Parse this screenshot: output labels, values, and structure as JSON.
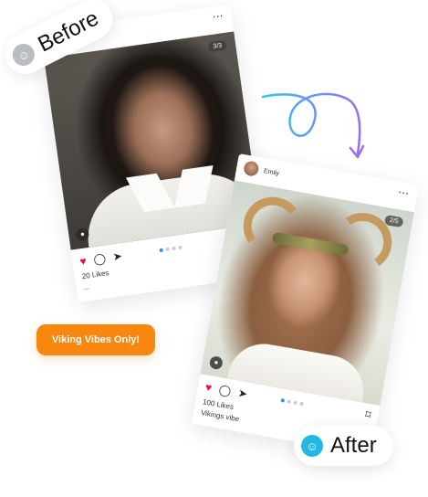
{
  "before_badge": {
    "label": "Before",
    "icon": "smiley-icon"
  },
  "after_badge": {
    "label": "After",
    "icon": "smiley-icon"
  },
  "before_post": {
    "counter": "3/3",
    "likes": "20 Likes",
    "caption": "..."
  },
  "after_post": {
    "username": "Emily",
    "counter": "2/5",
    "likes": "100 Likes",
    "caption": "Vikings vibe"
  },
  "tag": {
    "label": "Viking Vibes Only!"
  },
  "colors": {
    "heart": "#e5143a",
    "tag_bg": "#f7870f",
    "dot_active": "#2f8ef4",
    "after_icon": "#21b7e6",
    "arrow_start": "#2ec7f0",
    "arrow_end": "#9a6bf2"
  }
}
